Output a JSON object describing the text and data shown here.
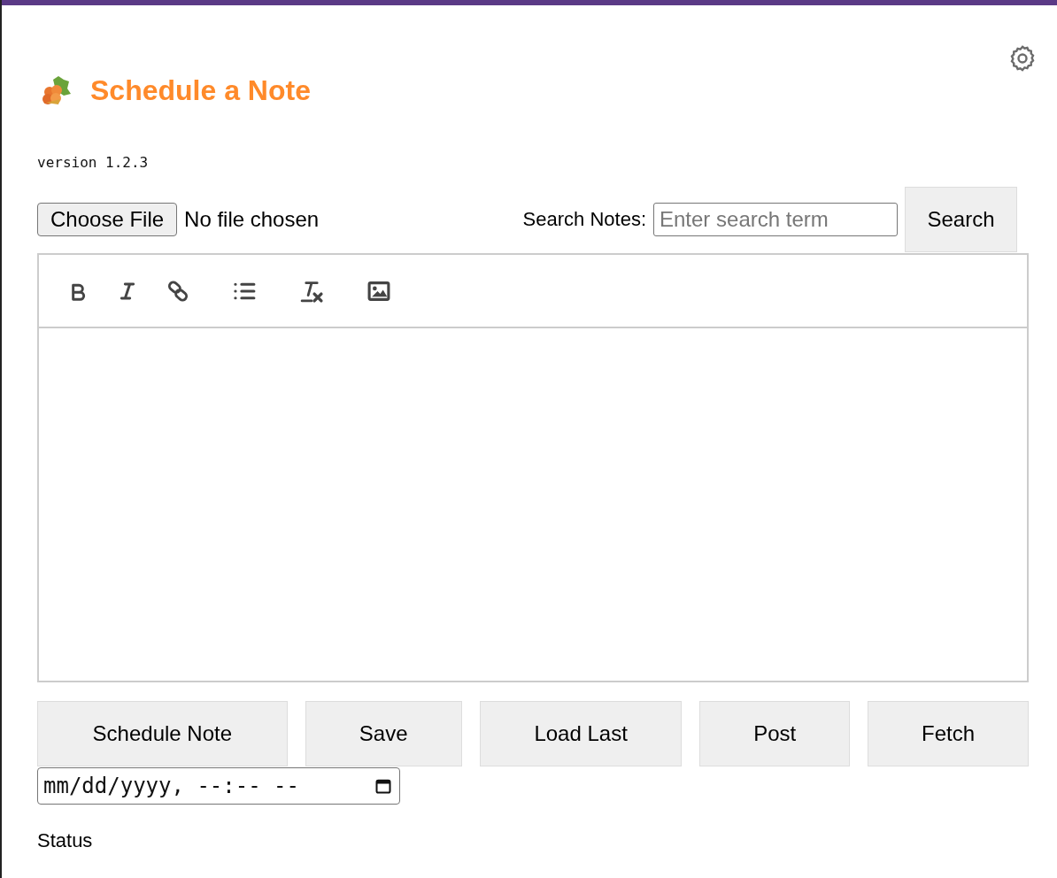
{
  "header": {
    "title": "Schedule a Note",
    "version": "version 1.2.3"
  },
  "file_picker": {
    "button": "Choose File",
    "status": "No file chosen"
  },
  "search": {
    "label": "Search Notes:",
    "placeholder": "Enter search term",
    "button": "Search"
  },
  "editor_toolbar": [
    {
      "kind": "bold"
    },
    {
      "kind": "italic"
    },
    {
      "kind": "link"
    },
    {
      "kind": "list"
    },
    {
      "kind": "clear-format"
    },
    {
      "kind": "image"
    }
  ],
  "actions": [
    "Schedule Note",
    "Save",
    "Load Last",
    "Post",
    "Fetch"
  ],
  "datetime_field": {
    "placeholder": "mm/dd/yyyy, --:-- --"
  },
  "status": "Status"
}
